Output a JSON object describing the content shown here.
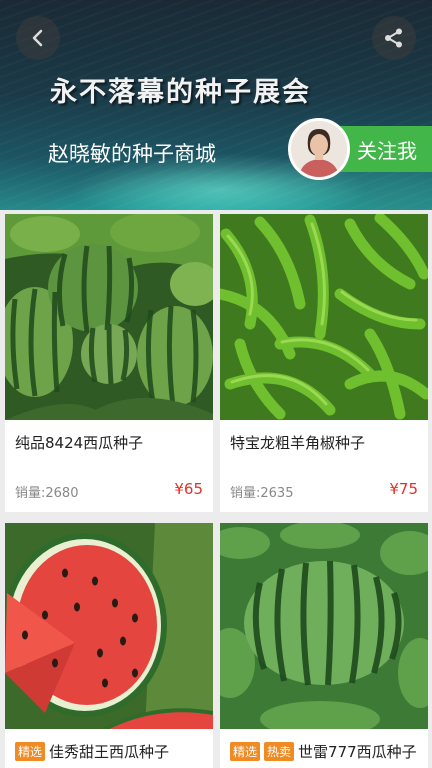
{
  "header": {
    "back_icon": "chevron-left-icon",
    "share_icon": "share-icon",
    "banner_title": "永不落幕的种子展会",
    "shop_name": "赵晓敏的种子商城",
    "follow_label": "关注我"
  },
  "products": [
    {
      "name": "纯品8424西瓜种子",
      "sales": "销量:2680",
      "price": "¥65",
      "tags": []
    },
    {
      "name": "特宝龙粗羊角椒种子",
      "sales": "销量:2635",
      "price": "¥75",
      "tags": []
    },
    {
      "name": "佳秀甜王西瓜种子",
      "tags": [
        "精选"
      ]
    },
    {
      "name": "世雷777西瓜种子",
      "tags": [
        "精选",
        "热卖"
      ]
    }
  ],
  "colors": {
    "accent_green": "#43b649",
    "price_red": "#e0312a",
    "tag_orange": "#f08a22"
  }
}
